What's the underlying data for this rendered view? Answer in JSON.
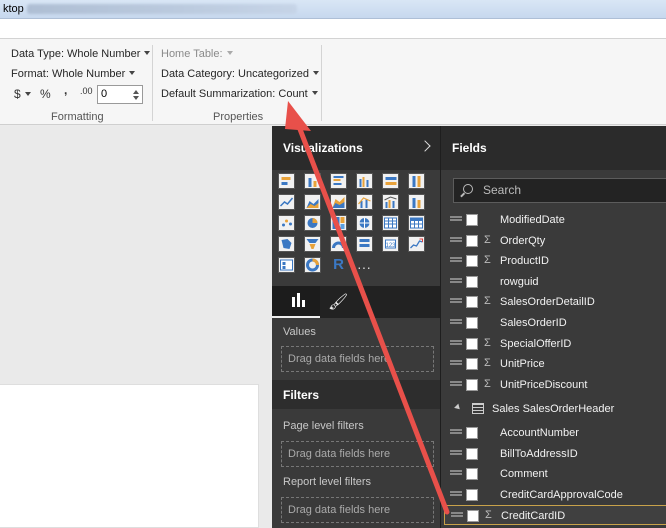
{
  "title_bar": {
    "text": "ktop"
  },
  "ribbon": {
    "formatting": {
      "data_type": "Data Type: Whole Number",
      "format": "Format: Whole Number",
      "currency": "$",
      "percent": "%",
      "comma": ",",
      "decimal": ".00",
      "decimal_places": "0",
      "group_label": "Formatting"
    },
    "properties": {
      "home_table": "Home Table:",
      "data_category": "Data Category: Uncategorized",
      "default_summarization": "Default Summarization: Count",
      "group_label": "Properties"
    }
  },
  "visualizations": {
    "title": "Visualizations",
    "values_label": "Values",
    "drop_hint": "Drag data fields here",
    "icons": [
      "stacked-bar-chart-icon",
      "stacked-column-chart-icon",
      "clustered-bar-chart-icon",
      "clustered-column-chart-icon",
      "100-stacked-bar-chart-icon",
      "100-stacked-column-chart-icon",
      "line-chart-icon",
      "area-chart-icon",
      "stacked-area-chart-icon",
      "line-and-stacked-column-chart-icon",
      "line-and-clustered-column-chart-icon",
      "ribbon-chart-icon",
      "scatter-chart-icon",
      "pie-chart-icon",
      "treemap-icon",
      "map-icon",
      "table-icon",
      "matrix-icon",
      "filled-map-icon",
      "funnel-icon",
      "gauge-icon",
      "multi-row-card-icon",
      "card-icon",
      "kpi-icon",
      "slicer-icon",
      "donut-chart-icon",
      "r-script-visual-icon"
    ],
    "r_glyph": "R",
    "more": "···"
  },
  "filters": {
    "title": "Filters",
    "page_level": "Page level filters",
    "report_level": "Report level filters",
    "drop_hint": "Drag data fields here"
  },
  "fields": {
    "title": "Fields",
    "search_placeholder": "Search",
    "rows_top": [
      {
        "name": "ModifiedDate",
        "sigma": ""
      },
      {
        "name": "OrderQty",
        "sigma": "Σ"
      },
      {
        "name": "ProductID",
        "sigma": "Σ"
      },
      {
        "name": "rowguid",
        "sigma": ""
      },
      {
        "name": "SalesOrderDetailID",
        "sigma": "Σ"
      },
      {
        "name": "SalesOrderID",
        "sigma": ""
      },
      {
        "name": "SpecialOfferID",
        "sigma": "Σ"
      },
      {
        "name": "UnitPrice",
        "sigma": "Σ"
      },
      {
        "name": "UnitPriceDiscount",
        "sigma": "Σ"
      }
    ],
    "table_name": "Sales SalesOrderHeader",
    "rows_bottom": [
      {
        "name": "AccountNumber",
        "sigma": ""
      },
      {
        "name": "BillToAddressID",
        "sigma": ""
      },
      {
        "name": "Comment",
        "sigma": ""
      },
      {
        "name": "CreditCardApprovalCode",
        "sigma": ""
      },
      {
        "name": "CreditCardID",
        "sigma": "Σ"
      }
    ]
  },
  "colors": {
    "arrow": "#e8504a",
    "pane_bg": "#3a3a3a",
    "selection": "#c8a24a"
  }
}
